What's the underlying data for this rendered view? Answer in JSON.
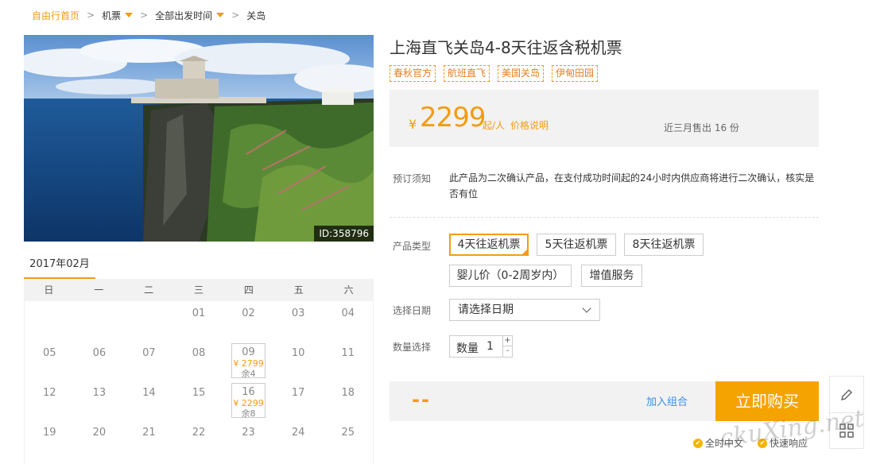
{
  "breadcrumb": {
    "home": "自由行首页",
    "flight": "机票",
    "departure": "全部出发时间",
    "destination": "关岛"
  },
  "hero": {
    "id_label": "ID:358796"
  },
  "calendar": {
    "month": "2017年02月",
    "weekdays": [
      "日",
      "一",
      "二",
      "三",
      "四",
      "五",
      "六"
    ],
    "rows": [
      [
        {
          "day": ""
        },
        {
          "day": ""
        },
        {
          "day": ""
        },
        {
          "day": "01"
        },
        {
          "day": "02"
        },
        {
          "day": "03"
        },
        {
          "day": "04"
        }
      ],
      [
        {
          "day": "05"
        },
        {
          "day": "06"
        },
        {
          "day": "07"
        },
        {
          "day": "08"
        },
        {
          "day": "09",
          "price": "¥ 2799",
          "left": "余4"
        },
        {
          "day": "10"
        },
        {
          "day": "11"
        }
      ],
      [
        {
          "day": "12"
        },
        {
          "day": "13"
        },
        {
          "day": "14"
        },
        {
          "day": "15"
        },
        {
          "day": "16",
          "price": "¥ 2299",
          "left": "余8"
        },
        {
          "day": "17"
        },
        {
          "day": "18"
        }
      ],
      [
        {
          "day": "19"
        },
        {
          "day": "20"
        },
        {
          "day": "21"
        },
        {
          "day": "22"
        },
        {
          "day": "23"
        },
        {
          "day": "24"
        },
        {
          "day": "25"
        }
      ]
    ]
  },
  "product": {
    "title": "上海直飞关岛4-8天往返含税机票",
    "tags": [
      "春秋官方",
      "航班直飞",
      "美国关岛",
      "伊甸田园"
    ],
    "price": {
      "yen": "¥",
      "amount": "2299",
      "per": "起/人",
      "explain": "价格说明",
      "sold": "近三月售出 16 份"
    },
    "notice_label": "预订须知",
    "notice_text": "此产品为二次确认产品，在支付成功时间起的24小时内供应商将进行二次确认，核实是否有位",
    "type_label": "产品类型",
    "types": [
      "4天往返机票",
      "5天往返机票",
      "8天往返机票",
      "婴儿价（0-2周岁内）",
      "增值服务"
    ],
    "date_label": "选择日期",
    "date_placeholder": "请选择日期",
    "qty_label": "数量选择",
    "qty_inner_label": "数量",
    "qty_value": "1",
    "qty_plus": "+",
    "qty_minus": "-"
  },
  "buy_bar": {
    "total": "--",
    "combo": "加入组合",
    "buy": "立即购买"
  },
  "features": [
    "全时中文",
    "快速响应"
  ],
  "watermark": "ckuXing.net",
  "colors": {
    "accent": "#f39c12",
    "buy": "#f5a300",
    "link": "#3a8ee6"
  }
}
